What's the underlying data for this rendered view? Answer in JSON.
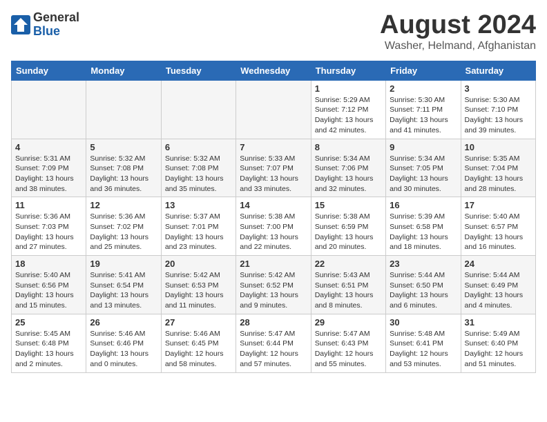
{
  "header": {
    "logo_general": "General",
    "logo_blue": "Blue",
    "month_title": "August 2024",
    "location": "Washer, Helmand, Afghanistan"
  },
  "weekdays": [
    "Sunday",
    "Monday",
    "Tuesday",
    "Wednesday",
    "Thursday",
    "Friday",
    "Saturday"
  ],
  "weeks": [
    [
      {
        "day": "",
        "info": "",
        "empty": true
      },
      {
        "day": "",
        "info": "",
        "empty": true
      },
      {
        "day": "",
        "info": "",
        "empty": true
      },
      {
        "day": "",
        "info": "",
        "empty": true
      },
      {
        "day": "1",
        "info": "Sunrise: 5:29 AM\nSunset: 7:12 PM\nDaylight: 13 hours\nand 42 minutes."
      },
      {
        "day": "2",
        "info": "Sunrise: 5:30 AM\nSunset: 7:11 PM\nDaylight: 13 hours\nand 41 minutes."
      },
      {
        "day": "3",
        "info": "Sunrise: 5:30 AM\nSunset: 7:10 PM\nDaylight: 13 hours\nand 39 minutes."
      }
    ],
    [
      {
        "day": "4",
        "info": "Sunrise: 5:31 AM\nSunset: 7:09 PM\nDaylight: 13 hours\nand 38 minutes."
      },
      {
        "day": "5",
        "info": "Sunrise: 5:32 AM\nSunset: 7:08 PM\nDaylight: 13 hours\nand 36 minutes."
      },
      {
        "day": "6",
        "info": "Sunrise: 5:32 AM\nSunset: 7:08 PM\nDaylight: 13 hours\nand 35 minutes."
      },
      {
        "day": "7",
        "info": "Sunrise: 5:33 AM\nSunset: 7:07 PM\nDaylight: 13 hours\nand 33 minutes."
      },
      {
        "day": "8",
        "info": "Sunrise: 5:34 AM\nSunset: 7:06 PM\nDaylight: 13 hours\nand 32 minutes."
      },
      {
        "day": "9",
        "info": "Sunrise: 5:34 AM\nSunset: 7:05 PM\nDaylight: 13 hours\nand 30 minutes."
      },
      {
        "day": "10",
        "info": "Sunrise: 5:35 AM\nSunset: 7:04 PM\nDaylight: 13 hours\nand 28 minutes."
      }
    ],
    [
      {
        "day": "11",
        "info": "Sunrise: 5:36 AM\nSunset: 7:03 PM\nDaylight: 13 hours\nand 27 minutes."
      },
      {
        "day": "12",
        "info": "Sunrise: 5:36 AM\nSunset: 7:02 PM\nDaylight: 13 hours\nand 25 minutes."
      },
      {
        "day": "13",
        "info": "Sunrise: 5:37 AM\nSunset: 7:01 PM\nDaylight: 13 hours\nand 23 minutes."
      },
      {
        "day": "14",
        "info": "Sunrise: 5:38 AM\nSunset: 7:00 PM\nDaylight: 13 hours\nand 22 minutes."
      },
      {
        "day": "15",
        "info": "Sunrise: 5:38 AM\nSunset: 6:59 PM\nDaylight: 13 hours\nand 20 minutes."
      },
      {
        "day": "16",
        "info": "Sunrise: 5:39 AM\nSunset: 6:58 PM\nDaylight: 13 hours\nand 18 minutes."
      },
      {
        "day": "17",
        "info": "Sunrise: 5:40 AM\nSunset: 6:57 PM\nDaylight: 13 hours\nand 16 minutes."
      }
    ],
    [
      {
        "day": "18",
        "info": "Sunrise: 5:40 AM\nSunset: 6:56 PM\nDaylight: 13 hours\nand 15 minutes."
      },
      {
        "day": "19",
        "info": "Sunrise: 5:41 AM\nSunset: 6:54 PM\nDaylight: 13 hours\nand 13 minutes."
      },
      {
        "day": "20",
        "info": "Sunrise: 5:42 AM\nSunset: 6:53 PM\nDaylight: 13 hours\nand 11 minutes."
      },
      {
        "day": "21",
        "info": "Sunrise: 5:42 AM\nSunset: 6:52 PM\nDaylight: 13 hours\nand 9 minutes."
      },
      {
        "day": "22",
        "info": "Sunrise: 5:43 AM\nSunset: 6:51 PM\nDaylight: 13 hours\nand 8 minutes."
      },
      {
        "day": "23",
        "info": "Sunrise: 5:44 AM\nSunset: 6:50 PM\nDaylight: 13 hours\nand 6 minutes."
      },
      {
        "day": "24",
        "info": "Sunrise: 5:44 AM\nSunset: 6:49 PM\nDaylight: 13 hours\nand 4 minutes."
      }
    ],
    [
      {
        "day": "25",
        "info": "Sunrise: 5:45 AM\nSunset: 6:48 PM\nDaylight: 13 hours\nand 2 minutes."
      },
      {
        "day": "26",
        "info": "Sunrise: 5:46 AM\nSunset: 6:46 PM\nDaylight: 13 hours\nand 0 minutes."
      },
      {
        "day": "27",
        "info": "Sunrise: 5:46 AM\nSunset: 6:45 PM\nDaylight: 12 hours\nand 58 minutes."
      },
      {
        "day": "28",
        "info": "Sunrise: 5:47 AM\nSunset: 6:44 PM\nDaylight: 12 hours\nand 57 minutes."
      },
      {
        "day": "29",
        "info": "Sunrise: 5:47 AM\nSunset: 6:43 PM\nDaylight: 12 hours\nand 55 minutes."
      },
      {
        "day": "30",
        "info": "Sunrise: 5:48 AM\nSunset: 6:41 PM\nDaylight: 12 hours\nand 53 minutes."
      },
      {
        "day": "31",
        "info": "Sunrise: 5:49 AM\nSunset: 6:40 PM\nDaylight: 12 hours\nand 51 minutes."
      }
    ]
  ]
}
